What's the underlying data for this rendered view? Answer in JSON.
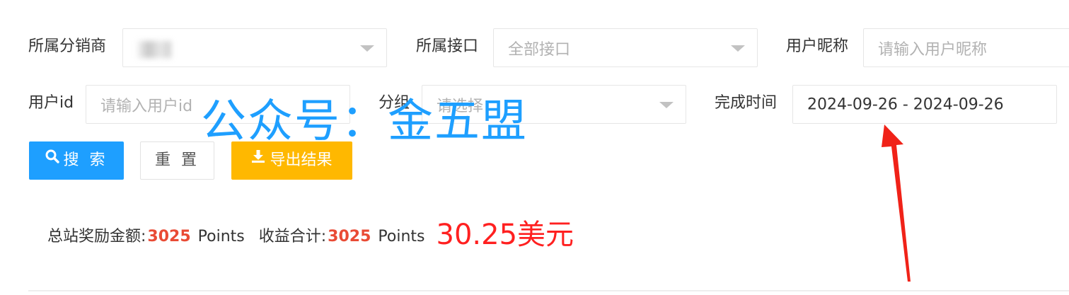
{
  "filters": {
    "distributor": {
      "label": "所属分销商",
      "value": ""
    },
    "interface": {
      "label": "所属接口",
      "value": "全部接口"
    },
    "nickname": {
      "label": "用户昵称",
      "placeholder": "请输入用户昵称"
    },
    "user_id": {
      "label": "用户id",
      "placeholder": "请输入用户id"
    },
    "group": {
      "label": "分组",
      "placeholder": "请选择"
    },
    "finish_time": {
      "label": "完成时间",
      "value": "2024-09-26 - 2024-09-26"
    }
  },
  "buttons": {
    "search": {
      "label": "搜 索",
      "icon": "search-icon"
    },
    "reset": {
      "label": "重 置"
    },
    "export": {
      "label": "导出结果",
      "icon": "download-icon"
    }
  },
  "watermark": "公众号：金五盟",
  "summary": {
    "total_reward_label": "总站奖励金额:",
    "total_reward_value": "3025",
    "total_reward_unit": "Points",
    "income_total_label": "收益合计:",
    "income_total_value": "3025",
    "income_total_unit": "Points",
    "usd_note": "30.25美元"
  },
  "colors": {
    "primary": "#1e9fff",
    "warm": "#ffb800",
    "highlight": "#e94b35",
    "annotation": "#ff2020"
  }
}
